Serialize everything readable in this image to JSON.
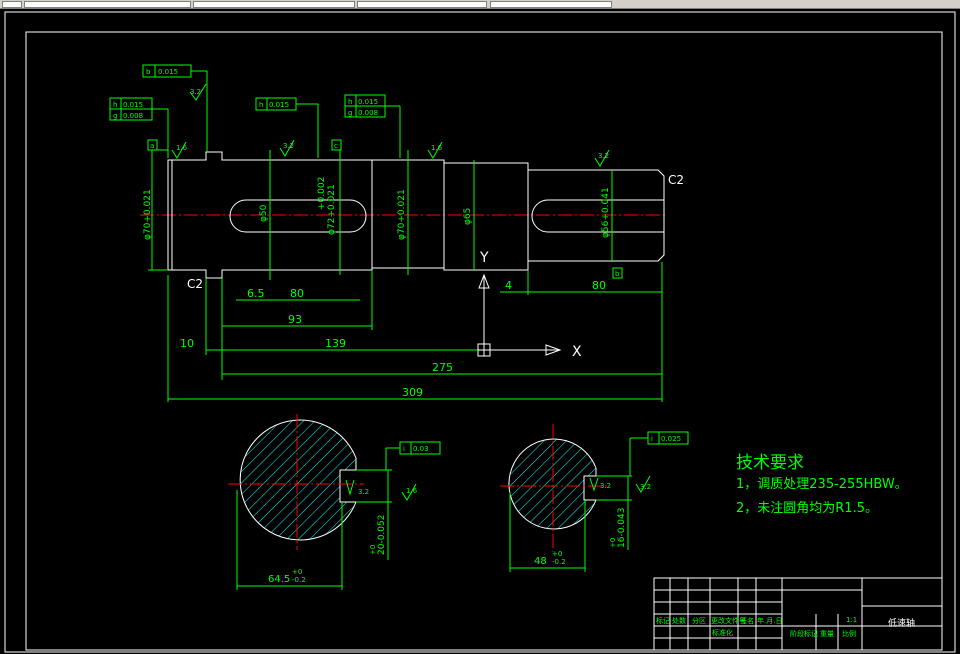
{
  "colors": {
    "background": "#000000",
    "outline": "#ffffff",
    "dimension": "#00ff00",
    "centerline": "#ff0000",
    "hatch": "#00ffff",
    "notes": "#00ff00"
  },
  "dims": {
    "len_309": "309",
    "len_275": "275",
    "len_139": "139",
    "len_93": "93",
    "len_80a": "80",
    "len_6_5": "6.5",
    "len_10": "10",
    "len_80b": "80",
    "len_4": "4",
    "dia_70a": "φ70+0.021",
    "dia_50": "φ50",
    "dia_72": "φ72+0.021",
    "dia_70b": "φ70+0.021",
    "dia_65": "φ65",
    "dia_56": "φ56+0.041",
    "tol_02": "+0.002",
    "tol_01": "+0.01",
    "chamfer_left": "C2",
    "chamfer_right": "C2",
    "sec1_width": "64.5",
    "sec1_tol_up": "+0",
    "sec1_tol_dn": "-0.2",
    "sec1_key": "20-0.052",
    "sec1_key_tol": "+0",
    "sec2_width": "48",
    "sec2_tol_up": "+0",
    "sec2_tol_dn": "-0.2",
    "sec2_key": "16-0.043",
    "sec2_key_tol": "+0"
  },
  "datums": {
    "a": "a",
    "c": "c",
    "b": "b"
  },
  "tolerance_frames": [
    {
      "sym": "b",
      "val": "0.015",
      "ref": "A"
    },
    {
      "sym": "h",
      "val": "0.015",
      "ref": "A"
    },
    {
      "sym": "g",
      "val": "0.008",
      "ref": ""
    },
    {
      "sym": "h",
      "val": "0.015",
      "ref": "A"
    },
    {
      "sym": "h",
      "val": "0.015",
      "ref": "A"
    },
    {
      "sym": "g",
      "val": "0.008",
      "ref": ""
    },
    {
      "sym": "i",
      "val": "0.03",
      "ref": "c"
    },
    {
      "sym": "i",
      "val": "0.025",
      "ref": "A"
    }
  ],
  "roughness": {
    "r1": "3.2",
    "r2": "1.6",
    "r3": "3.2",
    "r4": "1.6",
    "r5": "3.2",
    "r6": "1.6",
    "r7": "3.2",
    "r8": "3.2",
    "r9": "3.2"
  },
  "axes": {
    "y": "Y",
    "x": "X"
  },
  "notes": {
    "title": "技术要求",
    "line1": "1，调质处理235-255HBW。",
    "line2": "2，未注圆角均为R1.5。"
  },
  "title_block": {
    "part_name": "低速轴",
    "scale": "1:1",
    "row1": [
      "标记",
      "处数",
      "分区",
      "更改文件号",
      "签名",
      "年.月.日"
    ],
    "row2": [
      "阶段标记",
      "重量",
      "比例"
    ],
    "row3": "标准化"
  }
}
